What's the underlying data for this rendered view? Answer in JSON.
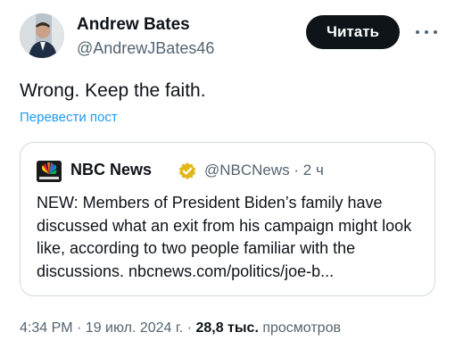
{
  "author": {
    "name": "Andrew Bates",
    "handle": "@AndrewJBates46"
  },
  "follow_button": {
    "label": "Читать"
  },
  "tweet": {
    "text": "Wrong. Keep the faith.",
    "translate_label": "Перевести пост"
  },
  "quote": {
    "name": "NBC News",
    "meta": "@NBCNews · 2 ч",
    "text": "NEW: Members of President Biden’s family have discussed what an exit from his campaign might look like, according to two people familiar with the discussions. nbcnews.com/politics/joe-b..."
  },
  "footer": {
    "timestamp": "4:34 PM · 19 июл. 2024 г. · ",
    "views_count": "28,8 тыс.",
    "views_label": " просмотров"
  },
  "icons": {
    "verified": "verified-badge-icon",
    "more": "more-dots-icon",
    "nbc_logo": "nbc-peacock-logo"
  },
  "colors": {
    "accent": "#1d9bf0",
    "text": "#0f1419",
    "secondary": "#536471",
    "border": "#cfd9de",
    "verified_gold": "#e2b719"
  }
}
